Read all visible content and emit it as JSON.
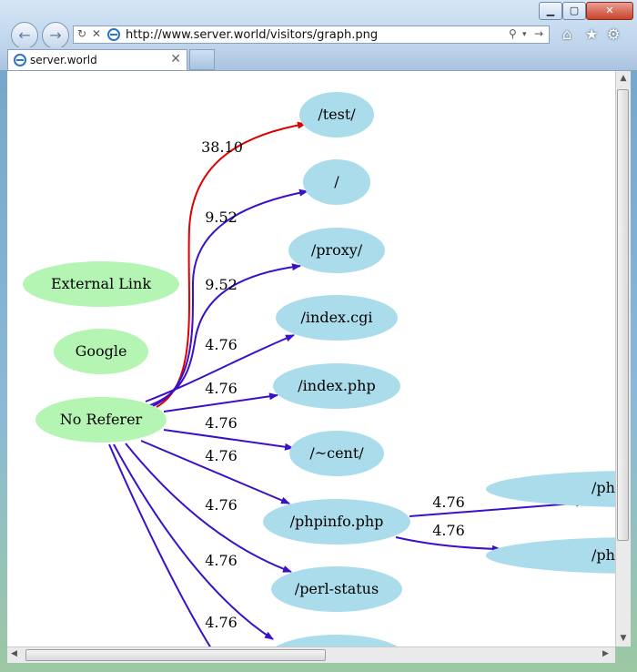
{
  "browser": {
    "url": "http://www.server.world/visitors/graph.png",
    "tab_title": "server.world",
    "window_buttons": [
      "minimize",
      "maximize",
      "close"
    ]
  },
  "graph": {
    "source_nodes": [
      "External Link",
      "Google",
      "No Referer"
    ],
    "target_nodes": [
      "/test/",
      "/",
      "/proxy/",
      "/index.cgi",
      "/index.php",
      "/~cent/",
      "/phpinfo.php",
      "/perl-status",
      "/ph",
      "/ph"
    ],
    "edge_labels": [
      "38.10",
      "9.52",
      "9.52",
      "4.76",
      "4.76",
      "4.76",
      "4.76",
      "4.76",
      "4.76",
      "4.76",
      "4.76",
      "4.76"
    ],
    "colors": {
      "node_source": "#b4f5b4",
      "node_target": "#abdcec",
      "edge_primary": "#e00000",
      "edge_secondary": "#3a10c8"
    }
  }
}
